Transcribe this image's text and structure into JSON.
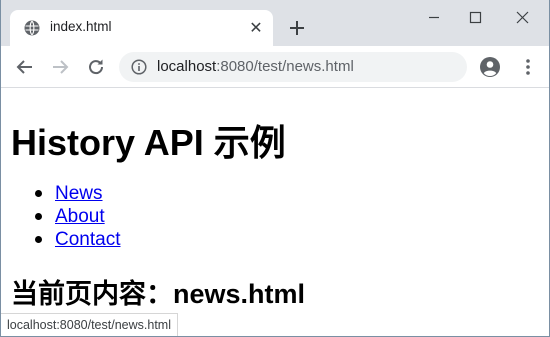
{
  "tab": {
    "title": "index.html",
    "close_glyph": "✕"
  },
  "toolbar": {
    "url_host": "localhost",
    "url_rest": ":8080/test/news.html"
  },
  "page": {
    "title": "History API 示例",
    "links": [
      "News",
      "About",
      "Contact"
    ],
    "current_content": "当前页内容：news.html"
  },
  "statusbar": {
    "url": "localhost:8080/test/news.html"
  },
  "colors": {
    "tabstrip": "#dee1e6",
    "omnibox": "#f1f3f4",
    "link": "#0000ee"
  }
}
